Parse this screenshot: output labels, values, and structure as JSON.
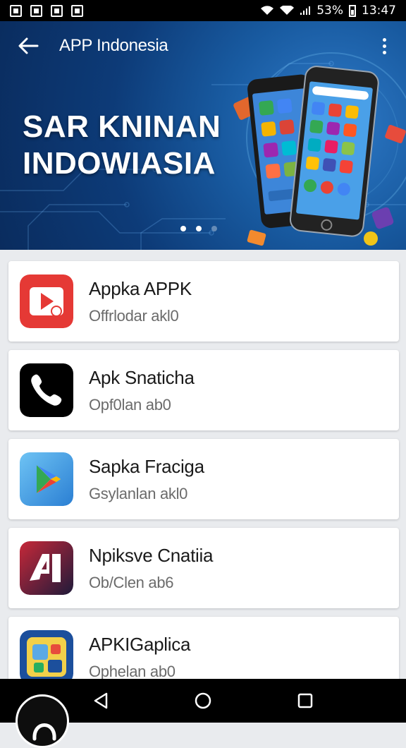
{
  "status_bar": {
    "battery": "53%",
    "time": "13:47"
  },
  "app_bar": {
    "title": "APP Indonesia",
    "back_icon": "arrow-left-icon",
    "menu_icon": "more-vert-icon"
  },
  "hero": {
    "title_line1": "SAR KNINAN",
    "title_line2": "INDOWIASIA",
    "carousel_pages": 3,
    "carousel_active_page": 2
  },
  "apps": [
    {
      "name": "Appka APPK",
      "subtitle": "Offrlodar akl0",
      "icon": "video-play-icon",
      "color": "#e53935"
    },
    {
      "name": "Apk Snaticha",
      "subtitle": "Opf0lan ab0",
      "icon": "phone-icon",
      "color": "#000000"
    },
    {
      "name": "Sapka Fraciga",
      "subtitle": "Gsylanlan akl0",
      "icon": "play-store-icon",
      "color": "#4fa3e8"
    },
    {
      "name": "Npiksve Cnatiia",
      "subtitle": "Ob/Clen ab6",
      "icon": "a-logo-icon",
      "color": "#8b1a2e"
    },
    {
      "name": "APKIGaplica",
      "subtitle": "Ophelan ab0",
      "icon": "apps-grid-icon",
      "color": "#1c4f9c"
    }
  ],
  "nav": {
    "back": "nav-back-icon",
    "home": "nav-home-icon",
    "recents": "nav-recents-icon"
  }
}
